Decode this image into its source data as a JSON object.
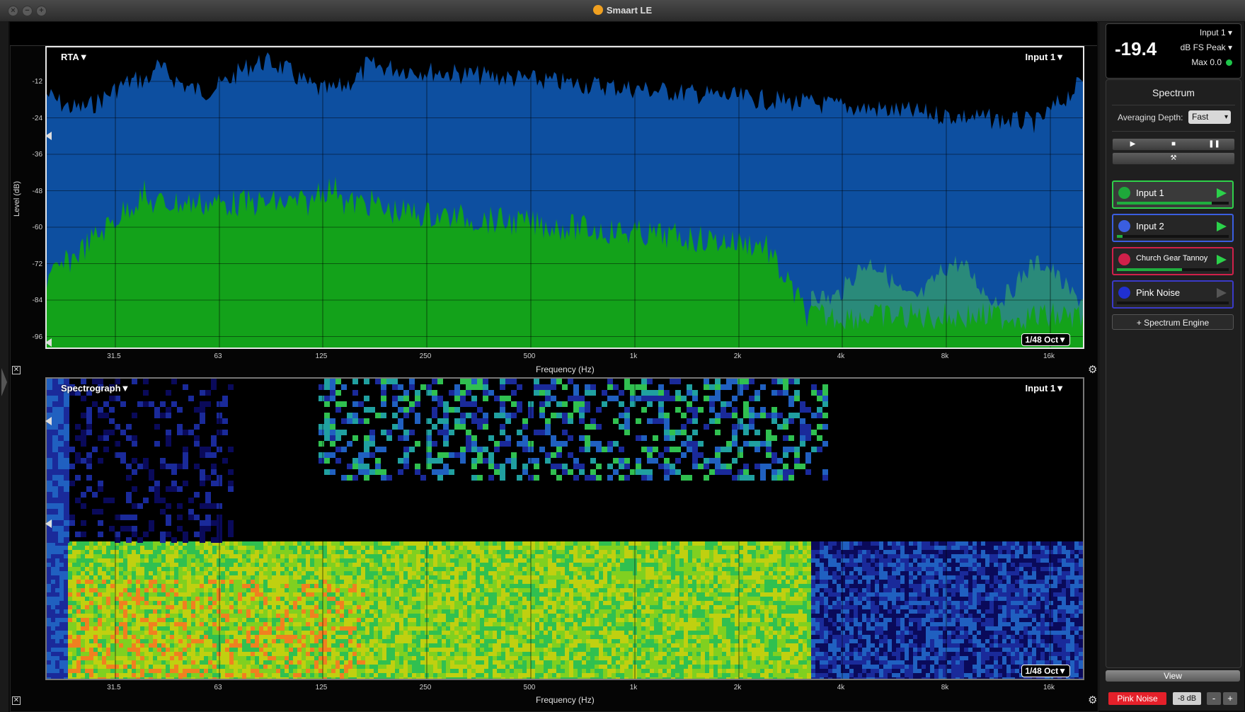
{
  "window": {
    "title": "Smaart LE"
  },
  "rta": {
    "label": "RTA▼",
    "input_label": "Input 1▼",
    "resolution": "1/48 Oct▼",
    "y_axis_title": "Level (dB)",
    "y_ticks": [
      "-12",
      "-24",
      "-36",
      "-48",
      "-60",
      "-72",
      "-84",
      "-96"
    ],
    "x_ticks": [
      "31.5",
      "63",
      "125",
      "250",
      "500",
      "1k",
      "2k",
      "4k",
      "8k",
      "16k"
    ],
    "x_axis_title": "Frequency (Hz)"
  },
  "spectrograph": {
    "label": "Spectrograph▼",
    "input_label": "Input 1▼",
    "resolution": "1/48 Oct▼",
    "x_ticks": [
      "31.5",
      "63",
      "125",
      "250",
      "500",
      "1k",
      "2k",
      "4k",
      "8k",
      "16k"
    ],
    "x_axis_title": "Frequency (Hz)"
  },
  "meter": {
    "value": "-19.4",
    "input": "Input 1",
    "mode": "dB FS Peak",
    "max": "Max 0.0"
  },
  "spectrum_panel": {
    "title": "Spectrum",
    "averaging_label": "Averaging Depth:",
    "averaging_value": "Fast",
    "engines": [
      {
        "name": "Input 1",
        "color": "#1ea83a",
        "border": "#2fd04a",
        "level": 0.85
      },
      {
        "name": "Input 2",
        "color": "#3a5ee0",
        "border": "#3a5ee0",
        "level": 0.05
      },
      {
        "name": "Church Gear Tannoy",
        "color": "#d0204a",
        "border": "#d0204a",
        "level": 0.58
      },
      {
        "name": "Pink Noise",
        "color": "#2030d0",
        "border": "#3a3ac8",
        "level": 0
      }
    ],
    "add_engine_label": "+ Spectrum Engine"
  },
  "bottom": {
    "view_label": "View",
    "generator_label": "Pink Noise",
    "generator_level": "-8 dB",
    "minus_label": "-",
    "plus_label": "+"
  },
  "colors": {
    "rta_blue": "#0d4fa0",
    "rta_green": "#13a21a",
    "rta_teal": "#2a8a7a",
    "accent_red": "#e5202a"
  }
}
